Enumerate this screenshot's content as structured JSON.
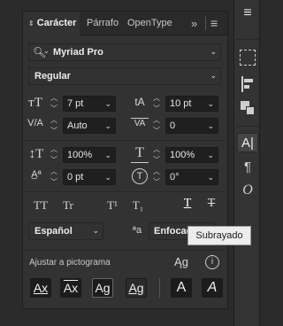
{
  "tabs": {
    "caracter": "Carácter",
    "parrafo": "Párrafo",
    "opentype": "OpenType",
    "overflow": "»",
    "menu": "≡"
  },
  "font": {
    "family": "Myriad Pro",
    "style": "Regular"
  },
  "metrics": {
    "size": "7 pt",
    "leading": "10 pt",
    "kerning": "Auto",
    "tracking": "0",
    "vscale": "100%",
    "hscale": "100%",
    "baseline": "0 pt",
    "rotation": "0°"
  },
  "typestyles": {
    "allcaps": "TT",
    "smallcaps": "Tr",
    "superscript": "T¹",
    "subscript": "T₁",
    "underline": "T",
    "strikethrough": "T"
  },
  "language": {
    "value": "Español",
    "antialias_icon": "ªa",
    "antialias_value": "Enfocado"
  },
  "tooltip": "Subrayado",
  "snap": {
    "label": "Ajustar a pictograma"
  }
}
